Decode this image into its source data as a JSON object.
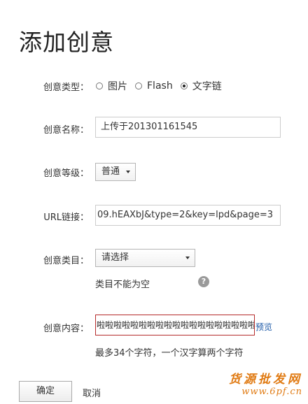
{
  "page": {
    "title": "添加创意"
  },
  "form": {
    "type": {
      "label": "创意类型：",
      "options": [
        {
          "label": "图片",
          "selected": false
        },
        {
          "label": "Flash",
          "selected": false
        },
        {
          "label": "文字链",
          "selected": true
        }
      ]
    },
    "name": {
      "label": "创意名称：",
      "value": "上传于201301161545"
    },
    "level": {
      "label": "创意等级：",
      "value": "普通"
    },
    "url": {
      "label": "URL链接：",
      "value": "09.hEAXbJ&type=2&key=lpd&page=3"
    },
    "category": {
      "label": "创意类目：",
      "value": "请选择",
      "error": "类目不能为空",
      "help_icon": "?"
    },
    "content": {
      "label": "创意内容：",
      "value": "啦啦啦啦啦啦啦啦啦啦啦啦啦啦啦啦啦啦啦啦",
      "preview_label": "预览",
      "hint": "最多34个字符，一个汉字算两个字符"
    }
  },
  "actions": {
    "confirm_label": "确定",
    "cancel_label": "取消"
  },
  "watermark": {
    "line1": "货源批发网",
    "line2": "www.6pf.cn"
  },
  "colors": {
    "error_border": "#b52b2b",
    "link": "#1e5aa8",
    "watermark": "#e07a12"
  }
}
